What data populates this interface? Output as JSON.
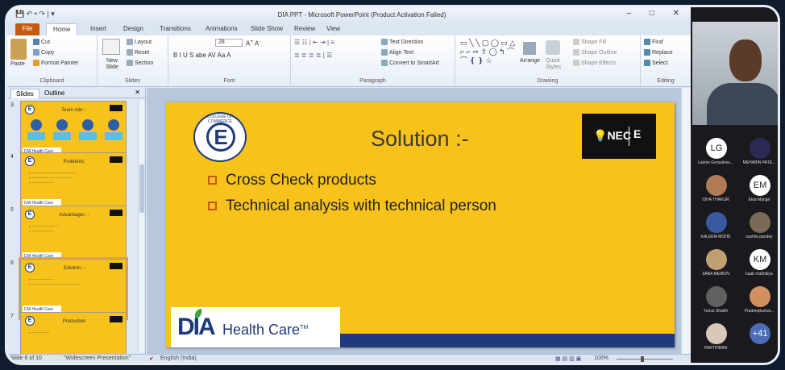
{
  "window": {
    "title": "DIA PPT - Microsoft PowerPoint (Product Activation Failed)",
    "qat": "💾 ↶ • ↷ | ▾",
    "controls": "– □ ✕"
  },
  "tabs": [
    "File",
    "Home",
    "Insert",
    "Design",
    "Transitions",
    "Animations",
    "Slide Show",
    "Review",
    "View"
  ],
  "ribbon": {
    "clipboard": {
      "paste": "Paste",
      "cut": "Cut",
      "copy": "Copy",
      "format_painter": "Format Painter",
      "label": "Clipboard"
    },
    "slides": {
      "new_slide": "New Slide",
      "layout": "Layout",
      "reset": "Reset",
      "section": "Section",
      "label": "Slides"
    },
    "font": {
      "size": "28",
      "label": "Font",
      "tools": "B  I  U  S  abe  AV  Aa  A"
    },
    "paragraph": {
      "text_direction": "Text Direction",
      "align_text": "Align Text",
      "smartart": "Convert to SmartArt",
      "label": "Paragraph"
    },
    "drawing": {
      "arrange": "Arrange",
      "quick_styles": "Quick Styles",
      "shape_fill": "Shape Fill",
      "shape_outline": "Shape Outline",
      "shape_effects": "Shape Effects",
      "label": "Drawing"
    },
    "editing": {
      "find": "Find",
      "replace": "Replace",
      "select": "Select",
      "label": "Editing"
    }
  },
  "pane": {
    "tabs": [
      "Slides",
      "Outline"
    ],
    "close": "✕",
    "thumbs": [
      {
        "num": "3",
        "title": "Team role :-"
      },
      {
        "num": "4",
        "title": "Problems:"
      },
      {
        "num": "5",
        "title": "Advantages :-"
      },
      {
        "num": "6",
        "title": "Solution :-",
        "selected": true
      },
      {
        "num": "7",
        "title": "Production"
      }
    ],
    "thumb_footer": "DIA Health Care"
  },
  "slide": {
    "title": "Solution :-",
    "bullets": [
      "Cross Check products",
      "Technical analysis with technical person"
    ],
    "logo_letter": "E",
    "logo_text": "COLLEGE OF COMMERCE",
    "nec_label": "NEC",
    "nec_e": "E",
    "dia_mark": "DIA",
    "dia_name": "Health Care",
    "dia_tm": "TM"
  },
  "status": {
    "slide": "Slide 6 of 10",
    "theme": "\"Widescreen Presentation\"",
    "language": "English (India)",
    "zoom": "100%"
  },
  "meeting": {
    "participants": [
      {
        "initials": "LG",
        "name": "Lakme Gonsalves...",
        "color": "#ffffff"
      },
      {
        "initials": "",
        "name": "MEHABIN PATE...",
        "color": "#2a2a55"
      },
      {
        "initials": "",
        "name": "ISHA THAKUR",
        "color": "#b07a55"
      },
      {
        "initials": "EM",
        "name": "Ekta Mange",
        "color": "#ffffff"
      },
      {
        "initials": "",
        "name": "KALEEM MOHD",
        "color": "#3a5aa0"
      },
      {
        "initials": "",
        "name": "sushila pandey",
        "color": "#7a6a55"
      },
      {
        "initials": "",
        "name": "SABA MEMON",
        "color": "#c0a070"
      },
      {
        "initials": "KM",
        "name": "kaab makhdiya",
        "color": "#ffffff"
      },
      {
        "initials": "",
        "name": "Yunus Shaikh",
        "color": "#606060"
      },
      {
        "initials": "",
        "name": "Pradeepkumar...",
        "color": "#d09060"
      },
      {
        "initials": "",
        "name": "PARTHIBAN",
        "color": "#d8c8b8"
      },
      {
        "initials": "+41",
        "name": "",
        "color": "#4b6cb7"
      }
    ]
  }
}
